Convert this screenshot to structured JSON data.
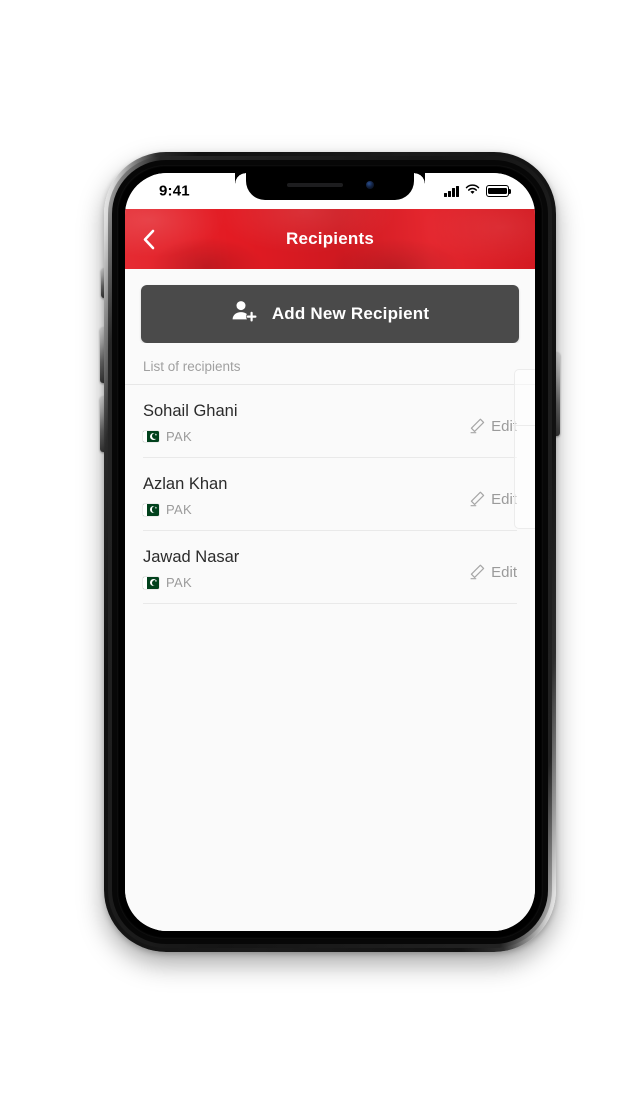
{
  "status_bar": {
    "time": "9:41",
    "signal_icon": "cellular-signal-icon",
    "wifi_icon": "wifi-icon",
    "battery_icon": "battery-full-icon"
  },
  "header": {
    "back_icon": "chevron-left-icon",
    "title": "Recipients",
    "background_color": "#e31b23"
  },
  "add_recipient": {
    "icon": "person-add-icon",
    "label": "Add New Recipient",
    "background_color": "#4a4a4a"
  },
  "list": {
    "section_header": "List of recipients",
    "edit_icon": "pencil-edit-icon",
    "edit_label": "Edit",
    "recipients": [
      {
        "name": "Sohail Ghani",
        "country_code": "PAK",
        "flag": "pakistan-flag-icon"
      },
      {
        "name": "Azlan Khan",
        "country_code": "PAK",
        "flag": "pakistan-flag-icon"
      },
      {
        "name": "Jawad Nasar",
        "country_code": "PAK",
        "flag": "pakistan-flag-icon"
      }
    ]
  },
  "device": {
    "notch_speaker": "earpiece-speaker",
    "notch_camera": "front-camera",
    "buttons": [
      "mute-switch",
      "volume-up",
      "volume-down",
      "power"
    ]
  }
}
